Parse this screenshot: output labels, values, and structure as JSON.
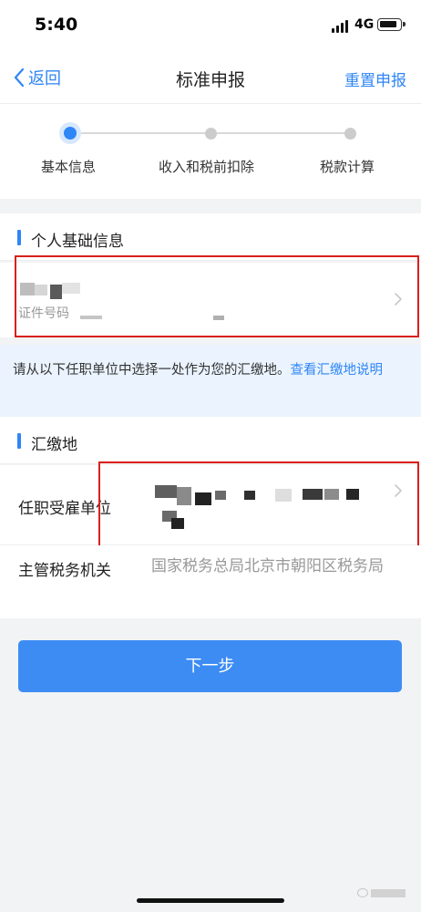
{
  "status_bar": {
    "time": "5:40",
    "network": "4G"
  },
  "nav": {
    "back_label": "返回",
    "title": "标准申报",
    "reset_label": "重置申报"
  },
  "stepper": {
    "steps": [
      {
        "label": "基本信息",
        "state": "active"
      },
      {
        "label": "收入和税前扣除",
        "state": "pending"
      },
      {
        "label": "税款计算",
        "state": "pending"
      }
    ]
  },
  "personal_section": {
    "title": "个人基础信息",
    "id_label": "证件号码"
  },
  "notice": {
    "text": "请从以下任职单位中选择一处作为您的汇缴地。",
    "link": "查看汇缴地说明"
  },
  "payment_section": {
    "title": "汇缴地",
    "employer_label": "任职受雇单位",
    "tax_authority_label": "主管税务机关",
    "tax_authority_value": "国家税务总局北京市朝阳区税务局"
  },
  "next_button": {
    "label": "下一步"
  },
  "colors": {
    "accent": "#2f86f6",
    "button": "#3d8cf4",
    "highlight": "#d9201c",
    "notice_bg": "#eaf3fe"
  }
}
